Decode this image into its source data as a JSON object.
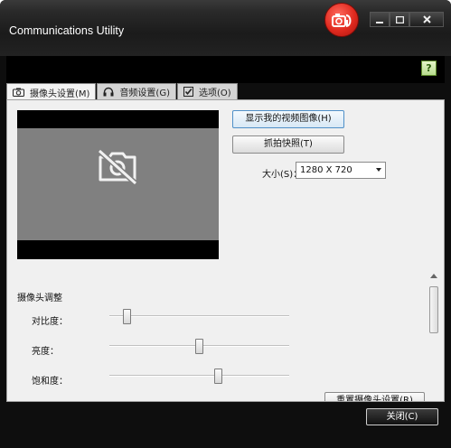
{
  "window": {
    "title": "Communications Utility",
    "controls": {
      "minimize": "–",
      "maximize": "□",
      "close": "✕"
    }
  },
  "help_icon": "?",
  "tabs": [
    {
      "label": "摄像头设置(M)",
      "icon": "camera-icon",
      "active": true
    },
    {
      "label": "音频设置(G)",
      "icon": "headset-icon",
      "active": false
    },
    {
      "label": "选项(O)",
      "icon": "checkbox-icon",
      "active": false
    }
  ],
  "camera": {
    "show_video_button": "显示我的视频图像(H)",
    "snapshot_button": "抓拍快照(T)",
    "size_label": "大小(S)：",
    "size_value": "1280 X 720",
    "preview_icon": "camera-off-icon"
  },
  "adjust": {
    "title": "摄像头调整",
    "sliders": [
      {
        "label": "对比度：",
        "value": 0.08
      },
      {
        "label": "亮度：",
        "value": 0.5
      },
      {
        "label": "饱和度：",
        "value": 0.61
      }
    ],
    "reset_button": "重置摄像头设置(R)"
  },
  "footer": {
    "close_button": "关闭(C)"
  },
  "colors": {
    "logo": "#e02a1f",
    "preview_bg": "#808080",
    "frame": "#0e0e0e"
  }
}
